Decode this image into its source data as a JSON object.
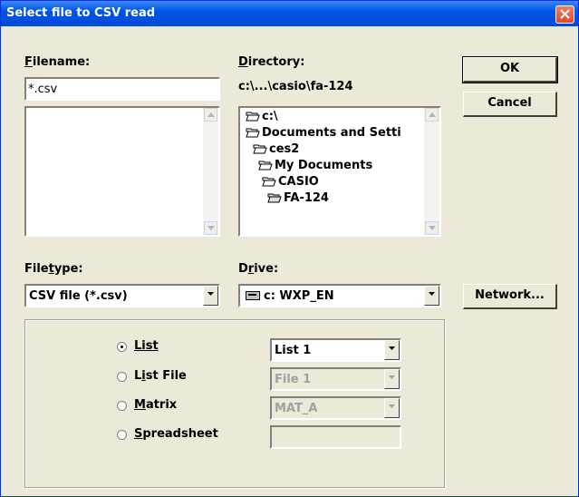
{
  "window": {
    "title": "Select file to CSV read"
  },
  "filename": {
    "label_key": "F",
    "label_rest": "ilename:",
    "value": "*.csv"
  },
  "directory": {
    "label_key": "D",
    "label_rest": "irectory:",
    "path": "c:\\...\\casio\\fa-124",
    "tree": [
      "c:\\",
      "Documents and Setti",
      "ces2",
      "My Documents",
      "CASIO",
      "FA-124"
    ]
  },
  "buttons": {
    "ok": "OK",
    "cancel": "Cancel",
    "network": "Network..."
  },
  "filetype": {
    "label_pre": "File",
    "label_key": "t",
    "label_rest": "ype:",
    "value": "CSV file (*.csv)"
  },
  "drive": {
    "label_pre": "D",
    "label_key": "r",
    "label_rest": "ive:",
    "value": "c: WXP_EN"
  },
  "options": {
    "list": {
      "label_key": "L",
      "label_rest": "ist",
      "select_value": "List 1",
      "selected": true
    },
    "list_file": {
      "label_pre": "L",
      "label_key": "i",
      "label_rest": "st File",
      "select_value": "File 1"
    },
    "matrix": {
      "label_key": "M",
      "label_rest": "atrix",
      "select_value": "MAT_A"
    },
    "spreadsheet": {
      "label_key": "S",
      "label_rest": "preadsheet",
      "input_value": ""
    }
  }
}
